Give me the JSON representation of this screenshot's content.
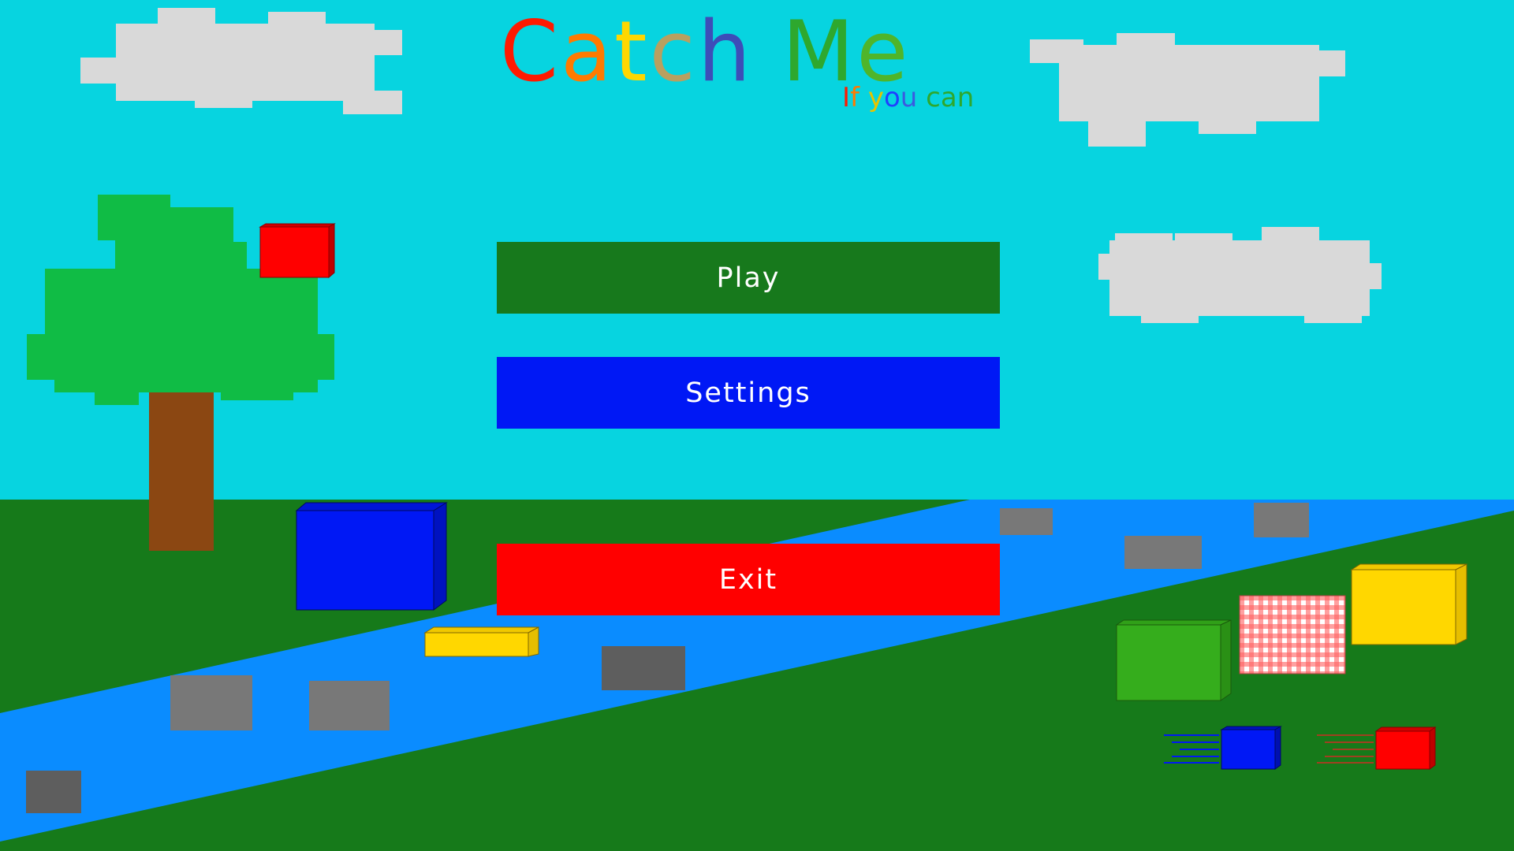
{
  "game": {
    "title_letters": [
      "C",
      "a",
      "t",
      "c",
      "h",
      " ",
      "M",
      "e"
    ],
    "subtitle_letters": [
      "I",
      "f",
      " ",
      "y",
      "o",
      "u",
      " ",
      "c",
      "a",
      "n"
    ]
  },
  "menu": {
    "play_label": "Play",
    "settings_label": "Settings",
    "exit_label": "Exit"
  },
  "colors": {
    "sky": "#07d4e0",
    "grass": "#167a1a",
    "river": "#0a8cff",
    "cloud": "#d9d9d9",
    "play_button": "#17791c",
    "settings_button": "#0018f5",
    "exit_button": "#ff0000",
    "title_gradient": [
      "#ff1a00",
      "#ff7a00",
      "#ffd700",
      "#b8a060",
      "#3d4db8",
      "#1a1aff",
      "#2ea82e",
      "#4fb52a"
    ],
    "subtitle_gradient": [
      "#ff1a00",
      "#ff7a00",
      "#ffd700",
      "#e6c400",
      "#2040ff",
      "#3a5be0",
      "#2ea82e",
      "#2ea82e",
      "#2ea82e",
      "#2ea82e"
    ]
  }
}
